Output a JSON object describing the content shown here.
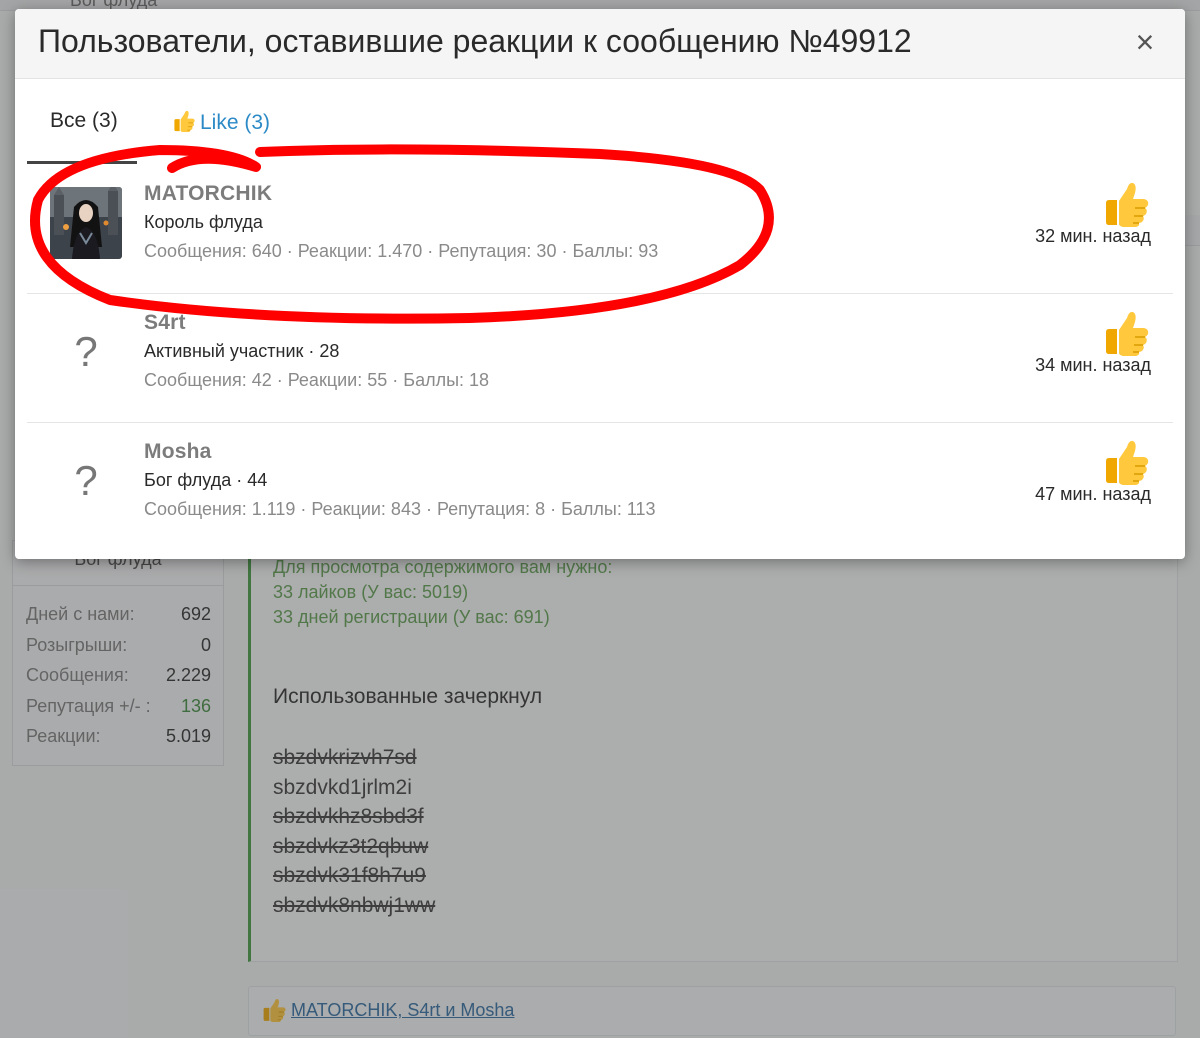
{
  "modal": {
    "title": "Пользователи, оставившие реакции к сообщению №49912",
    "close_symbol": "×",
    "tabs": [
      {
        "label": "Все (3)",
        "active": true
      },
      {
        "label": "Like (3)",
        "active": false,
        "icon": "thumbs-up-icon"
      }
    ],
    "reactions": [
      {
        "username": "MATORCHIK",
        "title": "Король флуда",
        "stats": "Сообщения: 640 · Реакции: 1.470 · Репутация: 30 · Баллы: 93",
        "time": "32 мин. назад",
        "avatar": "avatar-image"
      },
      {
        "username": "S4rt",
        "title": "Активный участник · 28",
        "stats": "Сообщения: 42 · Реакции: 55 · Баллы: 18",
        "time": "34 мин. назад",
        "avatar": "?"
      },
      {
        "username": "Mosha",
        "title": "Бог флуда · 44",
        "stats": "Сообщения: 1.119 · Реакции: 843 · Репутация: 8 · Баллы: 113",
        "time": "47 мин. назад",
        "avatar": "?"
      }
    ]
  },
  "background": {
    "top_clip_text": "Бог флуда",
    "profile": {
      "role": "Бог флуда",
      "stats": [
        {
          "label": "Дней с нами:",
          "value": "692"
        },
        {
          "label": "Розыгрыши:",
          "value": "0"
        },
        {
          "label": "Сообщения:",
          "value": "2.229"
        },
        {
          "label": "Репутация +/- :",
          "value": "136"
        },
        {
          "label": "Реакции:",
          "value": "5.019"
        }
      ]
    },
    "post": {
      "hidden_notice": [
        "Для просмотра содержимого вам нужно:",
        "33 лайков (У вас: 5019)",
        "33 дней регистрации (У вас: 691)"
      ],
      "text": "Использованные зачеркнул",
      "codes": [
        {
          "code": "sbzdvkrizvh7sd",
          "struck": true
        },
        {
          "code": "sbzdvkd1jrlm2i",
          "struck": false
        },
        {
          "code": "sbzdvkhz8sbd3f",
          "struck": true
        },
        {
          "code": "sbzdvkz3t2qbuw",
          "struck": true
        },
        {
          "code": "sbzdvk31f8h7u9",
          "struck": true
        },
        {
          "code": "sbzdvk8nbwj1ww",
          "struck": true
        }
      ]
    },
    "reactions_bar": {
      "users": "MATORCHIK, S4rt и Mosha"
    }
  },
  "colors": {
    "accent_link": "#2b8ac6",
    "annotation_red": "#ff0000",
    "hidden_notice_green": "#5c9e4e",
    "thumb_yellow": "#f5b400"
  }
}
